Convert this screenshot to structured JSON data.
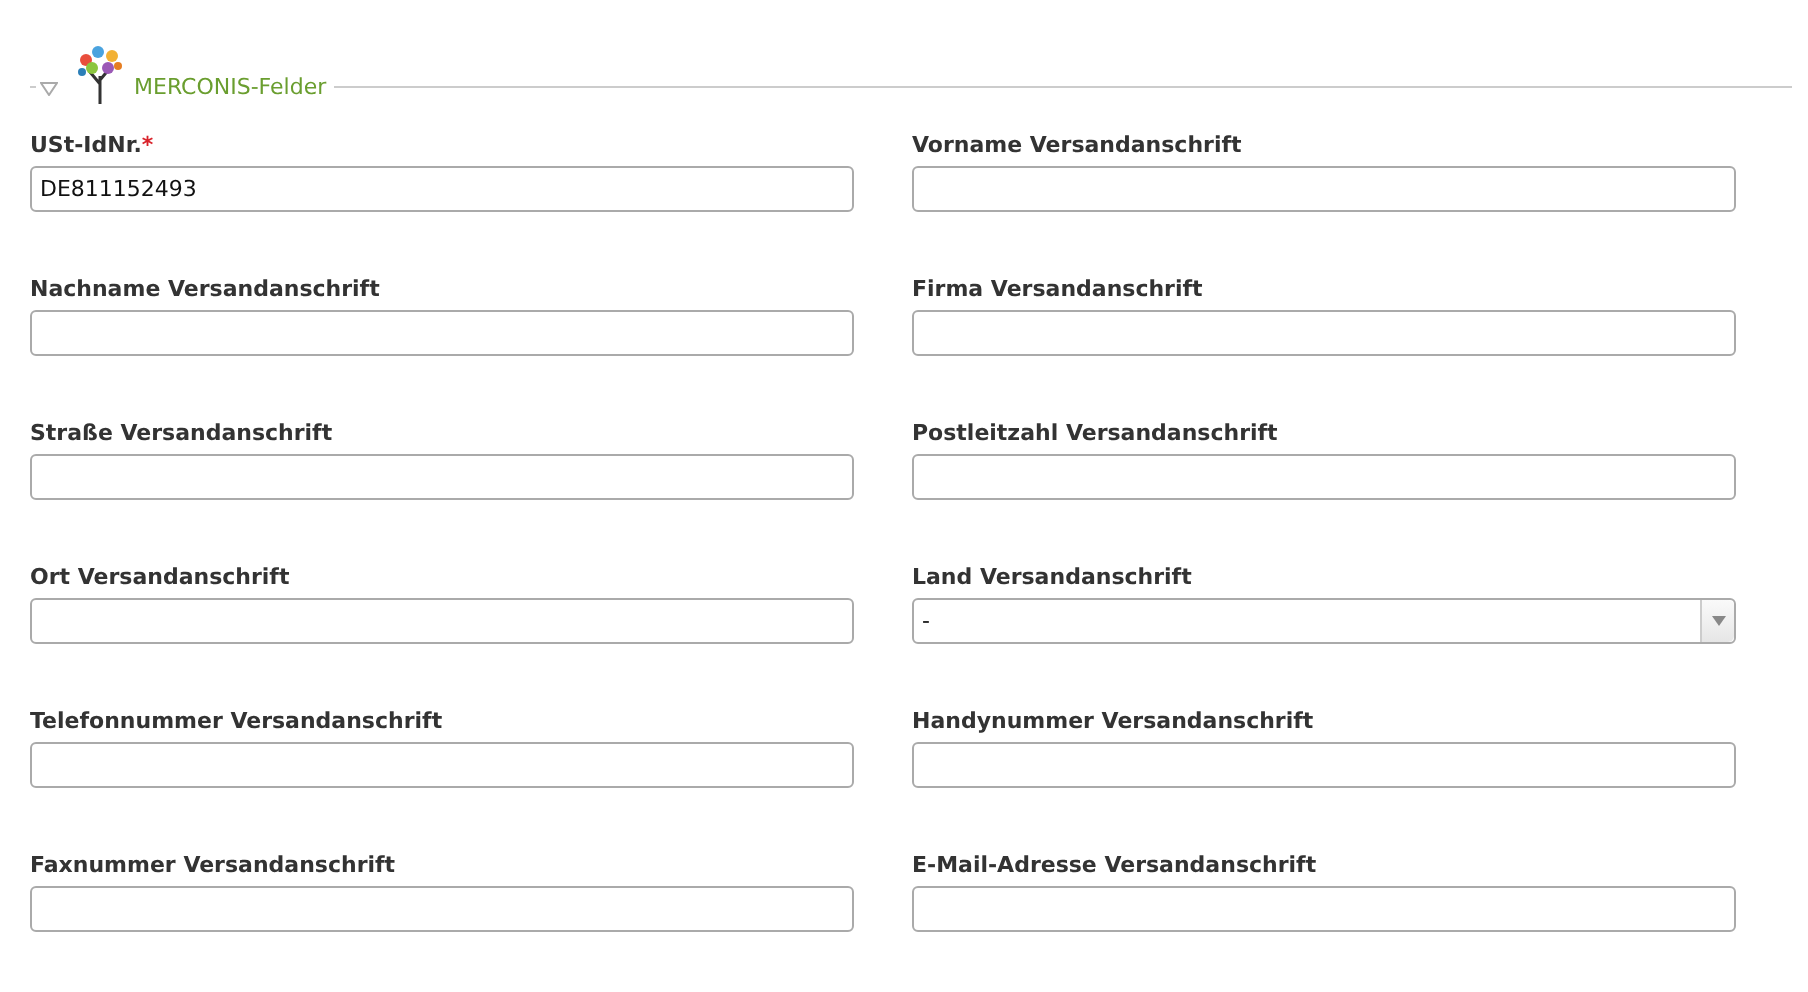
{
  "section": {
    "title": "MERCONIS-Felder",
    "expanded": true
  },
  "fields": [
    {
      "label": "USt-IdNr.",
      "marker": "*",
      "kind": "text",
      "value": "DE811152493"
    },
    {
      "label": "Vorname Versandanschrift",
      "kind": "text"
    },
    {
      "label": "Nachname Versandanschrift",
      "kind": "text"
    },
    {
      "label": "Firma Versandanschrift",
      "kind": "text"
    },
    {
      "label": "Straße Versandanschrift",
      "kind": "text"
    },
    {
      "label": "Postleitzahl Versandanschrift",
      "kind": "text"
    },
    {
      "label": "Ort Versandanschrift",
      "kind": "text"
    },
    {
      "label": "Land Versandanschrift",
      "kind": "select",
      "value": "-"
    },
    {
      "label": "Telefonnummer Versandanschrift",
      "kind": "text"
    },
    {
      "label": "Handynummer Versandanschrift",
      "kind": "text"
    },
    {
      "label": "Faxnummer Versandanschrift",
      "kind": "text"
    },
    {
      "label": "E-Mail-Adresse Versandanschrift",
      "kind": "text"
    }
  ]
}
